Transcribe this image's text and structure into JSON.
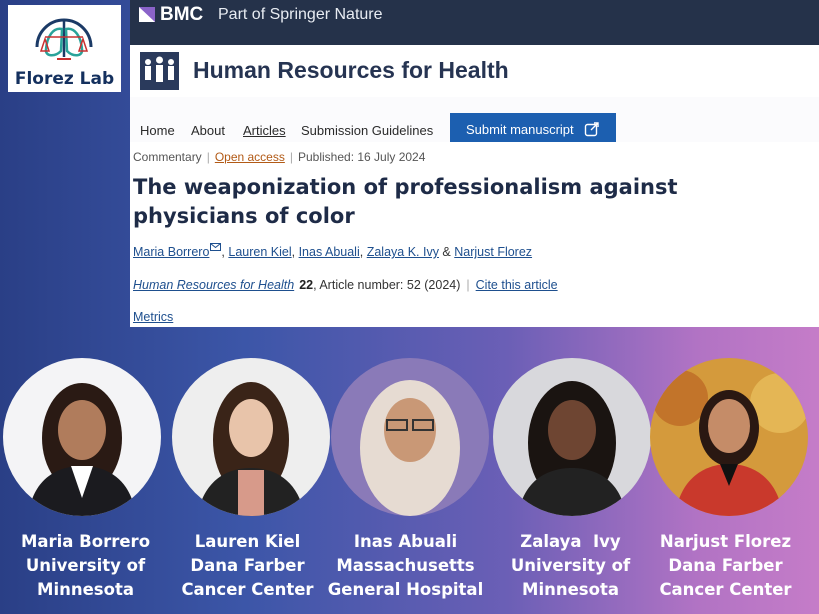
{
  "logo": {
    "text": "Florez Lab"
  },
  "publisher": {
    "brand": "BMC",
    "tagline": "Part of Springer Nature"
  },
  "journal": {
    "title": "Human Resources for Health"
  },
  "nav": {
    "items": [
      {
        "label": "Home",
        "active": false
      },
      {
        "label": "About",
        "active": false
      },
      {
        "label": "Articles",
        "active": true
      },
      {
        "label": "Submission Guidelines",
        "active": false
      }
    ],
    "submit_label": "Submit manuscript"
  },
  "article": {
    "type": "Commentary",
    "access": "Open access",
    "published": "Published: 16 July 2024",
    "title": "The weaponization of professionalism against physicians of color",
    "authors": [
      "Maria Borrero",
      "Lauren Kiel",
      "Inas Abuali",
      "Zalaya K. Ivy",
      "Narjust Florez"
    ],
    "author_sep": ", ",
    "author_and": " & ",
    "journal_name": "Human Resources for Health",
    "volume": "22",
    "article_number": ", Article number: 52 (2024)",
    "cite_label": "Cite this article",
    "metrics_label": "Metrics"
  },
  "people": [
    {
      "name": "Maria Borrero",
      "line2": "University of",
      "line3": "Minnesota"
    },
    {
      "name": "Lauren Kiel",
      "line2": "Dana Farber",
      "line3": "Cancer Center"
    },
    {
      "name": "Inas Abuali",
      "line2": "Massachusetts",
      "line3": "General Hospital"
    },
    {
      "name": "Zalaya  Ivy",
      "line2": "University of",
      "line3": "Minnesota"
    },
    {
      "name": "Narjust Florez",
      "line2": "Dana Farber",
      "line3": "Cancer Center"
    }
  ],
  "colors": {
    "header_bg": "#25324a",
    "submit_bg": "#1c5fb0",
    "link": "#1e4f8e",
    "open_access": "#b25a16"
  },
  "icons": [
    "lungs-scale-logo-icon",
    "bmc-logo-icon",
    "journal-people-icon",
    "external-link-icon",
    "envelope-icon"
  ]
}
